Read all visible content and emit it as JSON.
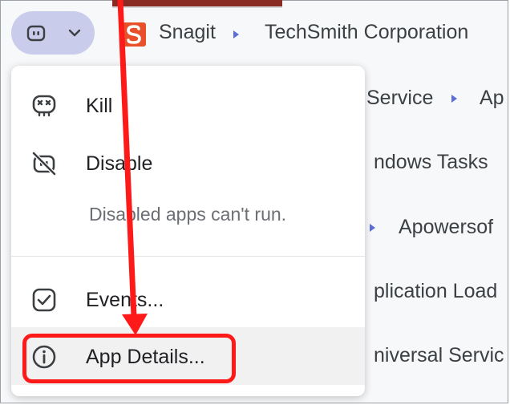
{
  "header": {
    "app_name": "Snagit",
    "publisher": "TechSmith Corporation"
  },
  "background_rows": [
    {
      "text": "Service",
      "trailing": "Ap"
    },
    {
      "text": "ndows Tasks"
    },
    {
      "text": "Apowersof"
    },
    {
      "text": "plication Load"
    },
    {
      "text": "niversal Servic"
    }
  ],
  "menu": {
    "items": [
      {
        "label": "Kill",
        "icon": "skull-icon"
      },
      {
        "label": "Disable",
        "icon": "disable-icon"
      },
      {
        "label": "Events...",
        "icon": "checkbox-icon"
      },
      {
        "label": "App Details...",
        "icon": "info-icon"
      }
    ],
    "hint": "Disabled apps can't run."
  },
  "colors": {
    "pill": "#c9ccea",
    "accent_dot": "#5b6fd8",
    "annotation_red": "#ff1a1a",
    "snagit_orange": "#e8502b"
  }
}
